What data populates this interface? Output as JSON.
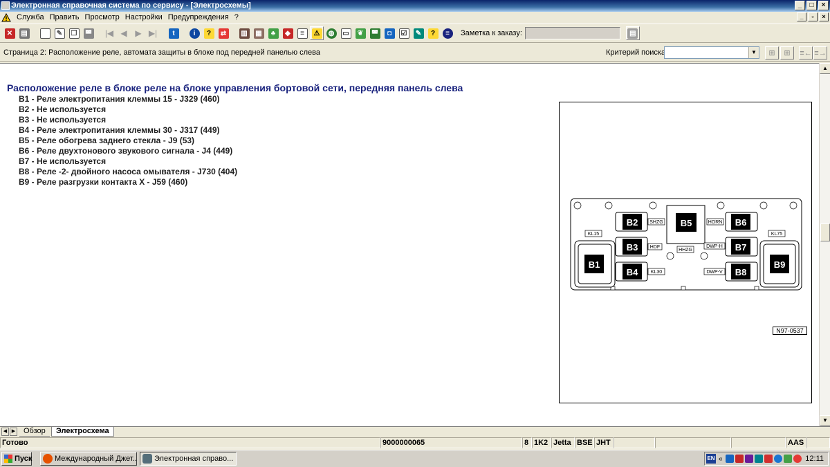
{
  "window": {
    "title": "Электронная справочная система по сервису - [Электросхемы]",
    "controls": [
      "_",
      "□",
      "×"
    ]
  },
  "menu": {
    "items": [
      "Служба",
      "Править",
      "Просмотр",
      "Настройки",
      "Предупреждения",
      "?"
    ],
    "mdi_controls": [
      "_",
      "▫",
      "×"
    ]
  },
  "toolbar": {
    "note_label": "Заметка к заказу:",
    "note_value": ""
  },
  "pagebar": {
    "title": "Страница 2: Расположение реле, автомата защиты в блоке под передней панелью слева",
    "search_label": "Критерий поиска:",
    "search_value": ""
  },
  "content": {
    "heading": "Расположение реле в блоке реле на блоке управления бортовой сети, передняя панель слева",
    "relays": [
      "B1 - Реле электропитания клеммы 15 - J329 (460)",
      "B2 - Не используется",
      "B3 - Не используется",
      "B4 - Реле электропитания клеммы 30 - J317 (449)",
      "B5 - Реле обогрева заднего стекла - J9 (53)",
      "B6 - Реле двухтонового звукового сигнала - J4 (449)",
      "B7 - Не используется",
      "B8 - Реле -2- двойного насоса омывателя - J730 (404)",
      "B9 - Реле разгрузки контакта X - J59 (460)"
    ],
    "diagram": {
      "ref_code": "N97-0537",
      "slots": [
        "B1",
        "B2",
        "B3",
        "B4",
        "B5",
        "B6",
        "B7",
        "B8",
        "B9"
      ],
      "labels": [
        "KL15",
        "SHZG",
        "HDF",
        "KL30",
        "HHZG",
        "HORN",
        "DWP-H",
        "DWP-V",
        "KL75"
      ]
    }
  },
  "tabs": {
    "overview": "Обзор",
    "scheme": "Электросхема"
  },
  "status": {
    "state": "Готово",
    "order": "9000000065",
    "c1": "8",
    "c2": "1K2",
    "c3": "Jetta",
    "c4": "BSE",
    "c5": "JHT",
    "c6": "AAS"
  },
  "taskbar": {
    "start": "Пуск",
    "task1": "Международный Джет...",
    "task2": "Электронная справо...",
    "lang": "EN",
    "clock": "12:11"
  },
  "colors": {
    "titlebar": "#0a246a",
    "heading": "#1a237e",
    "face": "#ece9d8"
  }
}
